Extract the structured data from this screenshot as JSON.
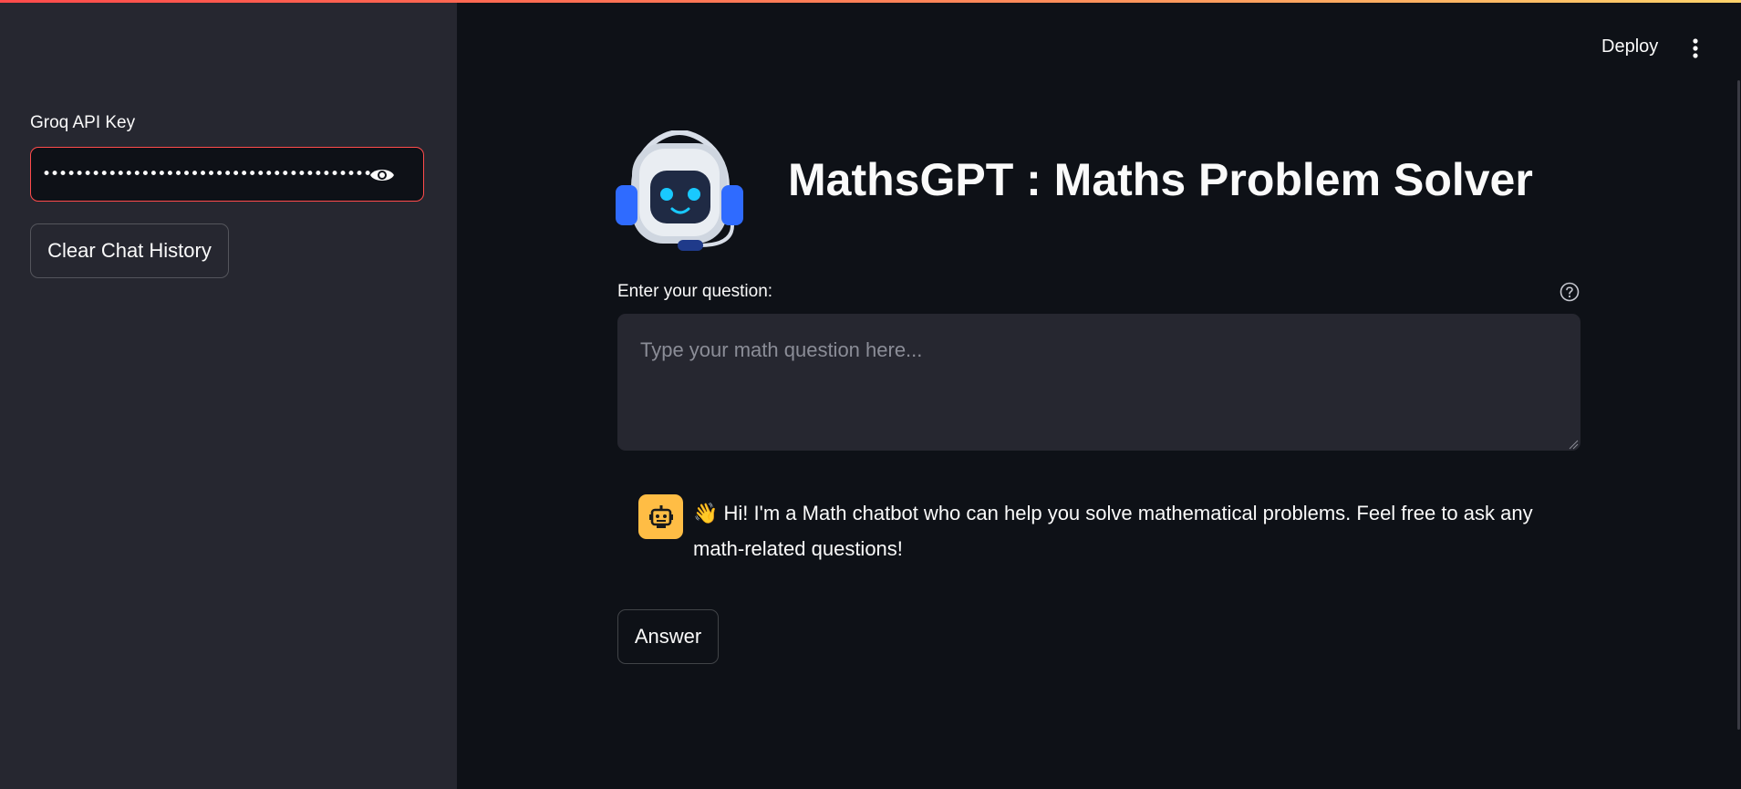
{
  "sidebar": {
    "api_key_label": "Groq API Key",
    "api_key_masked": "••••••••••••••••••••••••••••••••••••••••••••••••••••••••",
    "clear_button": "Clear Chat History"
  },
  "header": {
    "deploy_label": "Deploy"
  },
  "main": {
    "title": "MathsGPT : Maths Problem Solver",
    "question_label": "Enter your question:",
    "question_placeholder": "Type your math question here...",
    "chat_messages": [
      {
        "role": "assistant",
        "emoji": "👋",
        "text": "Hi! I'm a Math chatbot who can help you solve mathematical problems. Feel free to ask any math-related questions!"
      }
    ],
    "answer_button": "Answer"
  },
  "colors": {
    "background": "#0e1117",
    "sidebar": "#262730",
    "accent_red": "#ff4b4b",
    "avatar_bg": "#ffbd45",
    "robot_blue": "#2f6bff"
  },
  "icons": {
    "password_toggle": "eye-icon",
    "menu": "kebab-menu-icon",
    "help": "question-circle-icon",
    "logo": "robot-headset-icon",
    "avatar": "robot-avatar-icon"
  }
}
